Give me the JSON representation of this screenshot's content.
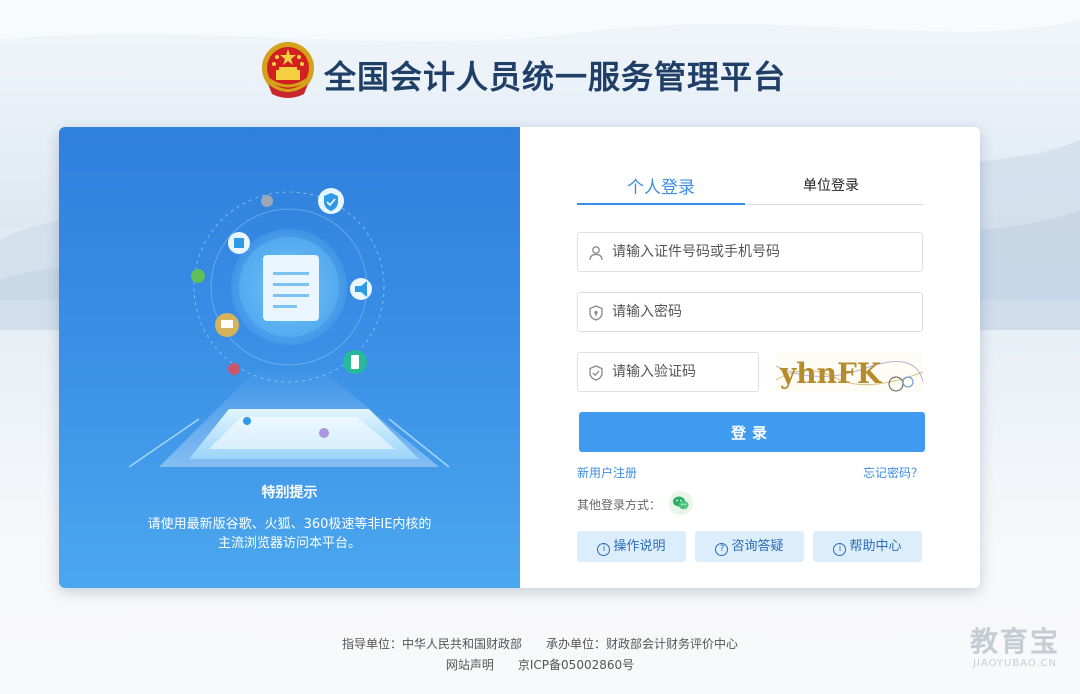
{
  "header": {
    "title": "全国会计人员统一服务管理平台"
  },
  "left_panel": {
    "tip_title": "特别提示",
    "tip_line1": "请使用最新版谷歌、火狐、360极速等非IE内核的",
    "tip_line2": "主流浏览器访问本平台。"
  },
  "login": {
    "tabs": [
      "个人登录",
      "单位登录"
    ],
    "active_tab": "个人登录",
    "id_placeholder": "请输入证件号码或手机号码",
    "password_placeholder": "请输入密码",
    "captcha_placeholder": "请输入验证码",
    "captcha_text": "yhnFK",
    "login_label": "登录",
    "register_label": "新用户注册",
    "forgot_label": "忘记密码？",
    "other_login_label": "其他登录方式：",
    "help_buttons": [
      "操作说明",
      "咨询答疑",
      "帮助中心"
    ]
  },
  "footer": {
    "guide": "指导单位：中华人民共和国财政部",
    "host": "承办单位：财政部会计财务评价中心",
    "statement": "网站声明",
    "icp": "京ICP备05002860号"
  },
  "watermark": {
    "name": "教育宝",
    "domain": "JIAOYUBAO.CN"
  },
  "colors": {
    "accent": "#3a8ee6",
    "button": "#3f9bf0",
    "title": "#1f3f66",
    "panel_top": "#2f7fdc",
    "panel_bottom": "#4ba7ee"
  }
}
